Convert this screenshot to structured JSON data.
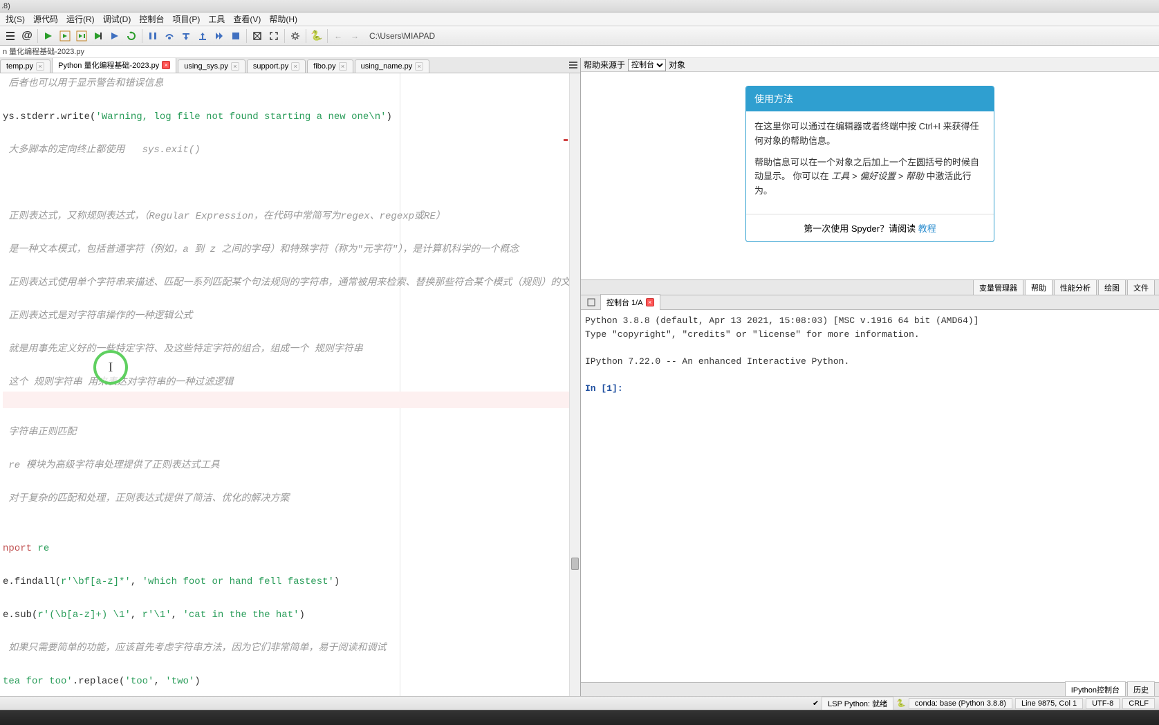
{
  "titlebar": ".8)",
  "menu": {
    "items": [
      "找(S)",
      "源代码",
      "运行(R)",
      "调试(D)",
      "控制台",
      "项目(P)",
      "工具",
      "查看(V)",
      "帮助(H)"
    ]
  },
  "toolbar": {
    "path": "C:\\Users\\MIAPAD"
  },
  "breadcrumb": "n 量化编程基础-2023.py",
  "editor": {
    "tabs": [
      {
        "label": "temp.py",
        "active": false,
        "closeStyle": "normal"
      },
      {
        "label": "Python 量化编程基础-2023.py",
        "active": true,
        "closeStyle": "red"
      },
      {
        "label": "using_sys.py",
        "active": false,
        "closeStyle": "normal"
      },
      {
        "label": "support.py",
        "active": false,
        "closeStyle": "normal"
      },
      {
        "label": "fibo.py",
        "active": false,
        "closeStyle": "normal"
      },
      {
        "label": "using_name.py",
        "active": false,
        "closeStyle": "normal"
      }
    ],
    "lines": [
      {
        "t": "comment",
        "text": " 后者也可以用于显示警告和错误信息"
      },
      {
        "t": "blank",
        "text": ""
      },
      {
        "t": "code",
        "segs": [
          {
            "c": "ident",
            "text": "ys.stderr.write("
          },
          {
            "c": "string",
            "text": "'Warning, log file not found starting a new one\\n'"
          },
          {
            "c": "ident",
            "text": ")"
          }
        ]
      },
      {
        "t": "blank",
        "text": ""
      },
      {
        "t": "comment",
        "text": " 大多脚本的定向终止都使用   sys.exit()"
      },
      {
        "t": "blank",
        "text": ""
      },
      {
        "t": "blank",
        "text": ""
      },
      {
        "t": "blank",
        "text": ""
      },
      {
        "t": "comment",
        "text": " 正则表达式，又称规则表达式，（Regular Expression，在代码中常简写为regex、regexp或RE）"
      },
      {
        "t": "blank",
        "text": ""
      },
      {
        "t": "comment",
        "text": " 是一种文本模式，包括普通字符（例如，a 到 z 之间的字母）和特殊字符（称为\"元字符\"），是计算机科学的一个概念"
      },
      {
        "t": "blank",
        "text": ""
      },
      {
        "t": "comment",
        "text": " 正则表达式使用单个字符串来描述、匹配一系列匹配某个句法规则的字符串，通常被用来检索、替换那些符合某个模式（规则）的文本"
      },
      {
        "t": "blank",
        "text": ""
      },
      {
        "t": "comment",
        "text": " 正则表达式是对字符串操作的一种逻辑公式"
      },
      {
        "t": "blank",
        "text": ""
      },
      {
        "t": "comment",
        "text": " 就是用事先定义好的一些特定字符、及这些特定字符的组合，组成一个 规则字符串"
      },
      {
        "t": "blank",
        "text": ""
      },
      {
        "t": "comment",
        "text": " 这个 规则字符串 用来表达对字符串的一种过滤逻辑"
      },
      {
        "t": "highlight",
        "text": ""
      },
      {
        "t": "blank",
        "text": ""
      },
      {
        "t": "comment",
        "text": " 字符串正则匹配"
      },
      {
        "t": "blank",
        "text": ""
      },
      {
        "t": "comment",
        "text": " re 模块为高级字符串处理提供了正则表达式工具"
      },
      {
        "t": "blank",
        "text": ""
      },
      {
        "t": "comment",
        "text": " 对于复杂的匹配和处理，正则表达式提供了简洁、优化的解决方案"
      },
      {
        "t": "blank",
        "text": ""
      },
      {
        "t": "blank",
        "text": ""
      },
      {
        "t": "code",
        "segs": [
          {
            "c": "kw",
            "text": "nport "
          },
          {
            "c": "mod",
            "text": "re"
          }
        ]
      },
      {
        "t": "blank",
        "text": ""
      },
      {
        "t": "code",
        "segs": [
          {
            "c": "ident",
            "text": "e.findall("
          },
          {
            "c": "string",
            "text": "r'\\bf[a-z]*'"
          },
          {
            "c": "ident",
            "text": ", "
          },
          {
            "c": "string",
            "text": "'which foot or hand fell fastest'"
          },
          {
            "c": "ident",
            "text": ")"
          }
        ]
      },
      {
        "t": "blank",
        "text": ""
      },
      {
        "t": "code",
        "segs": [
          {
            "c": "ident",
            "text": "e.sub("
          },
          {
            "c": "string",
            "text": "r'(\\b[a-z]+) \\1'"
          },
          {
            "c": "ident",
            "text": ", "
          },
          {
            "c": "string",
            "text": "r'\\1'"
          },
          {
            "c": "ident",
            "text": ", "
          },
          {
            "c": "string",
            "text": "'cat in the the hat'"
          },
          {
            "c": "ident",
            "text": ")"
          }
        ]
      },
      {
        "t": "blank",
        "text": ""
      },
      {
        "t": "comment",
        "text": " 如果只需要简单的功能，应该首先考虑字符串方法，因为它们非常简单，易于阅读和调试"
      },
      {
        "t": "blank",
        "text": ""
      },
      {
        "t": "code",
        "segs": [
          {
            "c": "string",
            "text": "tea for too'"
          },
          {
            "c": "ident",
            "text": ".replace("
          },
          {
            "c": "string",
            "text": "'too'"
          },
          {
            "c": "ident",
            "text": ", "
          },
          {
            "c": "string",
            "text": "'two'"
          },
          {
            "c": "ident",
            "text": ")"
          }
        ]
      }
    ]
  },
  "help": {
    "sourceLabel": "帮助来源于",
    "selectValue": "控制台",
    "objectLabel": "对象",
    "boxTitle": "使用方法",
    "p1": "在这里你可以通过在编辑器或者终端中按 Ctrl+I 来获得任何对象的帮助信息。",
    "p2a": "帮助信息可以在一个对象之后加上一个左圆括号的时候自动显示。 你可以在",
    "p2b": "工具 > 偏好设置 > 帮助",
    "p2c": "中激活此行为。",
    "footerText": "第一次使用 Spyder？请阅读",
    "footerLink": "教程",
    "tabs": [
      "变量管理器",
      "帮助",
      "性能分析",
      "绘图",
      "文件"
    ]
  },
  "console": {
    "tabLabel": "控制台 1/A",
    "line1": "Python 3.8.8 (default, Apr 13 2021, 15:08:03) [MSC v.1916 64 bit (AMD64)]",
    "line2": "Type \"copyright\", \"credits\" or \"license\" for more information.",
    "line3": "IPython 7.22.0 -- An enhanced Interactive Python.",
    "promptIn": "In [",
    "promptNum": "1",
    "promptEnd": "]:",
    "bottomTabs": [
      "IPython控制台",
      "历史"
    ]
  },
  "status": {
    "lsp": "LSP Python: 就绪",
    "conda": "conda: base (Python 3.8.8)",
    "line": "Line 9875, Col 1",
    "enc": "UTF-8",
    "eol": "CRLF"
  },
  "icons": {
    "python": "🐍"
  }
}
